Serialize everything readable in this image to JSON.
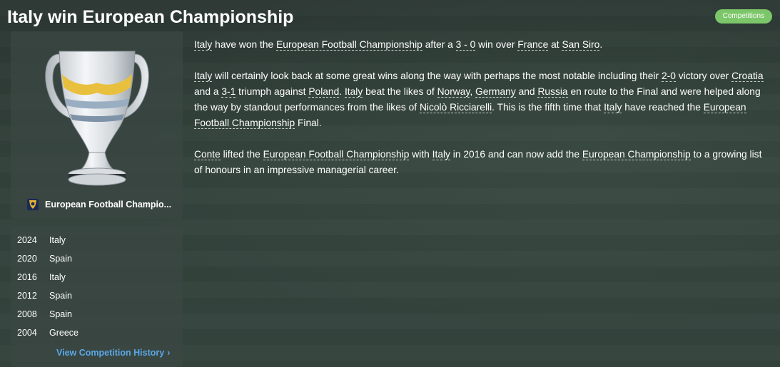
{
  "header": {
    "title": "Italy win European Championship",
    "badge": "Competitions"
  },
  "competition": {
    "name": "European Football Champio..."
  },
  "history": {
    "rows": [
      {
        "year": "2024",
        "winner": "Italy"
      },
      {
        "year": "2020",
        "winner": "Spain"
      },
      {
        "year": "2016",
        "winner": "Italy"
      },
      {
        "year": "2012",
        "winner": "Spain"
      },
      {
        "year": "2008",
        "winner": "Spain"
      },
      {
        "year": "2004",
        "winner": "Greece"
      }
    ],
    "link_label": "View Competition History",
    "link_chevron": "›"
  },
  "article": {
    "p1": {
      "team": "Italy",
      "t1": " have won the ",
      "competition": "European Football Championship",
      "t2": " after a ",
      "score": "3 - 0",
      "t3": " win over ",
      "opponent": "France",
      "t4": " at ",
      "stadium": "San Siro",
      "t5": "."
    },
    "p2": {
      "team": "Italy",
      "t1": " will certainly look back at some great wins along the way with perhaps the most notable including their ",
      "score1": "2-0",
      "t2": " victory over ",
      "opp1": "Croatia",
      "t3": " and a ",
      "score2": "3-1",
      "t4": " triumph against ",
      "opp2": "Poland",
      "t5": ". ",
      "team2": "Italy",
      "t6": " beat the likes of ",
      "opp3": "Norway",
      "t7": ", ",
      "opp4": "Germany",
      "t8": " and ",
      "opp5": "Russia",
      "t9": " en route to the Final and were helped along the way by standout performances from the likes of ",
      "player": "Nicolò Ricciarelli",
      "t10": ". This is the fifth time that ",
      "team3": "Italy",
      "t11": " have reached the ",
      "competition": "European Football Championship",
      "t12": " Final."
    },
    "p3": {
      "manager": "Conte",
      "t1": " lifted the ",
      "competition": "European Football Championship",
      "t2": " with ",
      "team": "Italy",
      "t3": " in 2016 and can now add the ",
      "competition_short": "European Championship",
      "t4": " to a growing list of honours in an impressive managerial career."
    }
  },
  "icons": {
    "trophy": "trophy-icon",
    "competition_logo": "competition-logo-icon",
    "chevron": "chevron-right-icon"
  },
  "colors": {
    "badge": "#7cc66a",
    "link": "#5aa8e6",
    "panel": "#3a4642"
  }
}
